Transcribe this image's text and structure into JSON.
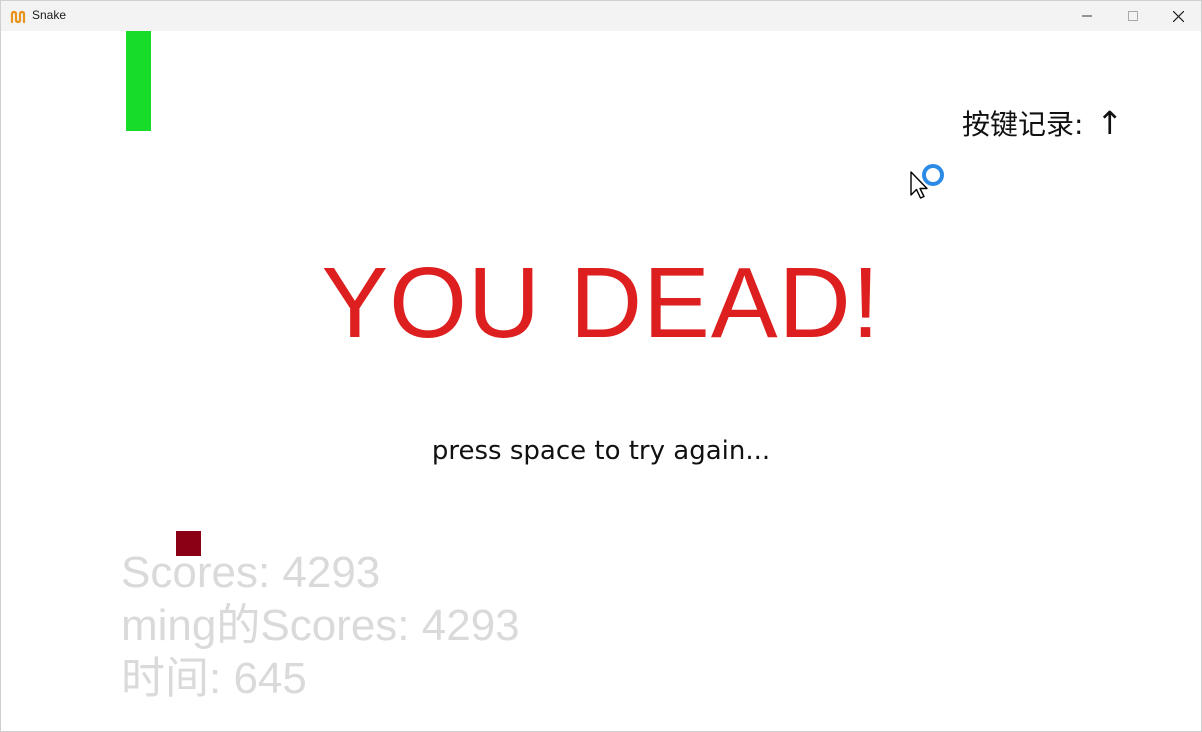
{
  "window": {
    "title": "Snake",
    "icon": "snake-app-icon",
    "controls": [
      "minimize-icon",
      "maximize-icon",
      "close-icon"
    ]
  },
  "game": {
    "key_record_label": "按键记录:",
    "key_record_value": "↑",
    "dead_message": "YOU DEAD!",
    "retry_message": "press space to try again...",
    "scores_line": "Scores: 4293",
    "user_scores_line": "ming的Scores: 4293",
    "time_line": "时间: 645"
  },
  "colors": {
    "snake": "#17dd2a",
    "food": "#8b0014",
    "dead_text": "#dd1f1f",
    "stats_text": "#dadada",
    "busy_ring": "#2b8be6"
  }
}
